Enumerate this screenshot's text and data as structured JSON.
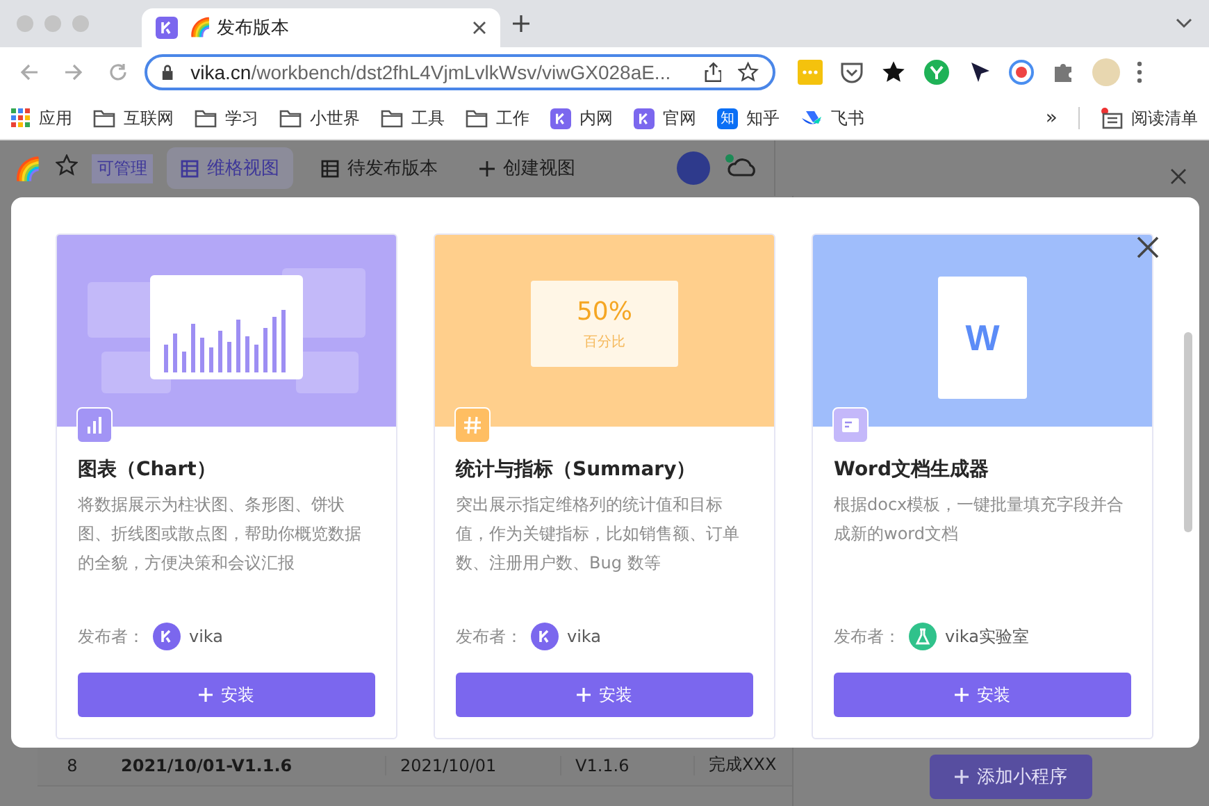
{
  "browser": {
    "tab": {
      "emoji": "🌈",
      "title": "发布版本"
    },
    "url": {
      "host": "vika.cn",
      "path": "/workbench/dst2fhL4VjmLvlkWsv/viwGX028aE..."
    },
    "bookmarks": [
      {
        "kind": "apps",
        "label": "应用"
      },
      {
        "kind": "folder",
        "label": "互联网"
      },
      {
        "kind": "folder",
        "label": "学习"
      },
      {
        "kind": "folder",
        "label": "小世界"
      },
      {
        "kind": "folder",
        "label": "工具"
      },
      {
        "kind": "folder",
        "label": "工作"
      },
      {
        "kind": "vika",
        "label": "内网"
      },
      {
        "kind": "vika",
        "label": "官网"
      },
      {
        "kind": "zhihu",
        "label": "知乎",
        "icon_text": "知"
      },
      {
        "kind": "feishu",
        "label": "飞书"
      }
    ],
    "more": "»",
    "reading_list": "阅读清单"
  },
  "app": {
    "emoji": "🌈",
    "permission": "可管理",
    "views": [
      {
        "label": "维格视图",
        "selected": true
      },
      {
        "label": "待发布版本",
        "selected": false
      }
    ],
    "create_view": "创建视图",
    "row": [
      "8",
      "2021/10/01-V1.1.6",
      "2021/10/01",
      "V1.1.6",
      "完成XXX"
    ],
    "add_widget": "添加小程序"
  },
  "modal": {
    "cards": [
      {
        "kind": "chart",
        "title": "图表（Chart）",
        "description": "将数据展示为柱状图、条形图、饼状图、折线图或散点图，帮助你概览数据的全貌，方便决策和会议汇报",
        "publisher_label": "发布者：",
        "publisher": {
          "kind": "vika",
          "name": "vika"
        },
        "install": "安装"
      },
      {
        "kind": "summary",
        "title": "统计与指标（Summary）",
        "description": "突出展示指定维格列的统计值和目标值，作为关键指标，比如销售额、订单数、注册用户数、Bug 数等",
        "publisher_label": "发布者：",
        "publisher": {
          "kind": "vika",
          "name": "vika"
        },
        "install": "安装",
        "art_value": "50%",
        "art_label": "百分比"
      },
      {
        "kind": "word",
        "title": "Word文档生成器",
        "description": "根据docx模板，一键批量填充字段并合成新的word文档",
        "publisher_label": "发布者：",
        "publisher": {
          "kind": "lab",
          "name": "vika实验室"
        },
        "install": "安装",
        "art_letter": "W"
      }
    ]
  }
}
